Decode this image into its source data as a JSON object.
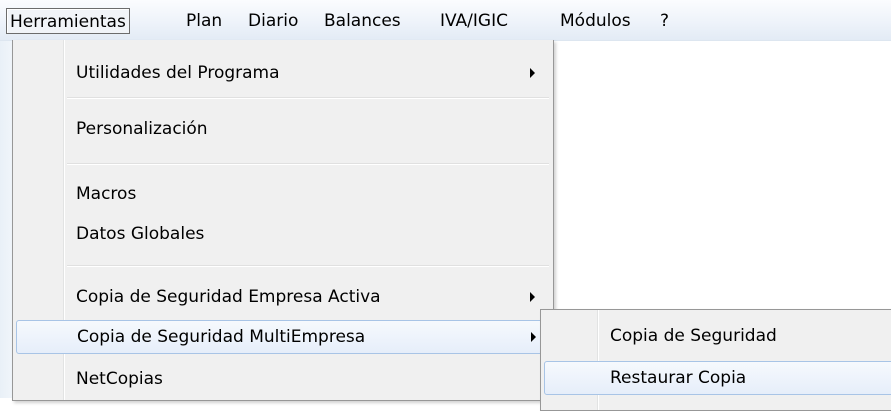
{
  "menubar": {
    "items": [
      "Herramientas",
      "Plan",
      "Diario",
      "Balances",
      "IVA/IGIC",
      "Módulos",
      "?"
    ]
  },
  "herramientas_menu": {
    "items": [
      {
        "label": "Utilidades del Programa",
        "submenu_arrow": true
      },
      {
        "label": "Personalización",
        "submenu_arrow": false
      },
      {
        "label": "Macros",
        "submenu_arrow": false
      },
      {
        "label": "Datos Globales",
        "submenu_arrow": false
      },
      {
        "label": "Copia de Seguridad Empresa Activa",
        "submenu_arrow": true
      },
      {
        "label": "Copia de Seguridad MultiEmpresa",
        "submenu_arrow": true,
        "highlighted": true
      },
      {
        "label": "NetCopias",
        "submenu_arrow": false
      }
    ]
  },
  "multiempresa_submenu": {
    "items": [
      {
        "label": "Copia de Seguridad"
      },
      {
        "label": "Restaurar Copia",
        "highlighted": true
      }
    ]
  },
  "colors": {
    "menu_bg": "#f0f0f0",
    "highlight_border": "#a8c4e6",
    "highlight_fill": "#e6eefa",
    "menubar_bg": "#eef3fa"
  }
}
